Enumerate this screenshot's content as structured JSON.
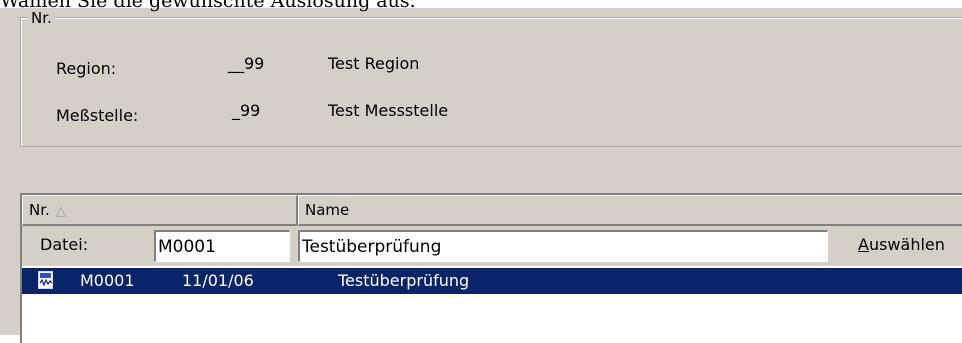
{
  "instruction": "Wählen Sie die gewünschte Auslösung aus.",
  "group": {
    "legend": "Nr.",
    "rows": [
      {
        "label": "Region:",
        "number": "__99",
        "name": "Test Region"
      },
      {
        "label": "Meßstelle:",
        "number": "_99",
        "name": "Test Messstelle"
      }
    ]
  },
  "list": {
    "columns": [
      {
        "label": "Nr.",
        "sort_icon": "sort-ascending-icon"
      },
      {
        "label": "Name"
      }
    ],
    "filter": {
      "label": "Datei:",
      "number_value": "M0001",
      "name_value": "Testüberprüfung",
      "select_label_accel": "A",
      "select_label_rest": "uswählen"
    },
    "rows": [
      {
        "icon": "waveform-file-icon",
        "number": "M0001",
        "date": "11/01/06",
        "name": "Testüberprüfung",
        "selected": true
      }
    ]
  },
  "colors": {
    "panel": "#d4d0c8",
    "selection": "#0a246a",
    "selection_text": "#ffffff"
  }
}
